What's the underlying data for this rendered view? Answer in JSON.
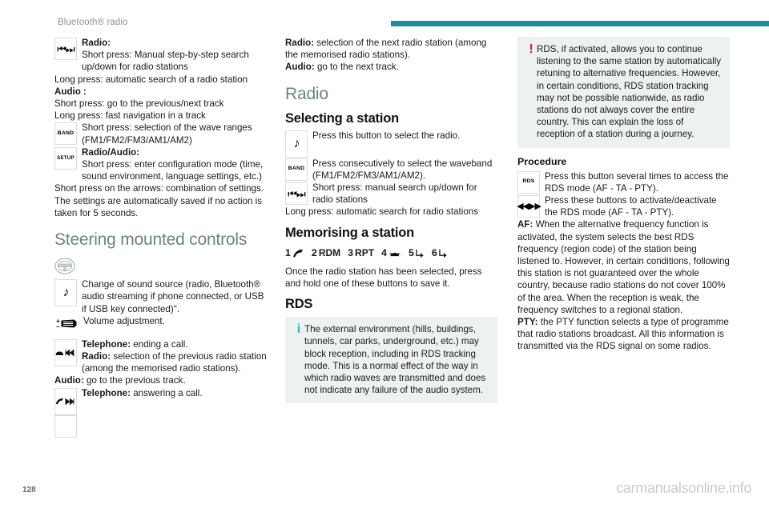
{
  "header": {
    "title": "Bluetooth® radio",
    "rule_color": "#1b8e98"
  },
  "footer": {
    "page_number": "128",
    "watermark": "carmanualsonline.info"
  },
  "column1": {
    "block_prev_next": {
      "icon": "prev-next-track-icon",
      "icon_glyph": "⏮⏭",
      "line1_label": "Radio:",
      "line1_text": "Short press: Manual step-by-step search up/down for radio stations",
      "line2": "Long press: automatic search of a radio station",
      "line3_label": "Audio :",
      "line4": "Short press: go to the previous/next track",
      "line5": "Long press: fast navigation in a track"
    },
    "block_band": {
      "icon_label": "BAND",
      "text": "Short press: selection of the wave ranges (FM1/FM2/FM3/AM1/AM2)"
    },
    "block_setup": {
      "icon_label": "SETUP",
      "line1_label": "Radio/Audio:",
      "line1_text": "Short press: enter configuration mode (time, sound environment, language settings, etc.)",
      "line2": "Short press on the arrows: combination of settings.",
      "line3": "The settings are automatically saved if no action is taken for 5 seconds."
    },
    "heading_steering": "Steering mounted controls",
    "block_source": {
      "wheel_icon": "steering-wheel-icon",
      "icon_glyph": "♪",
      "text": "Change of sound source (radio, Bluetooth® audio streaming if phone connected, or USB if USB key connected)\"."
    },
    "block_volume": {
      "plus": "+",
      "minus": "–",
      "text": "Volume adjustment."
    },
    "block_end_call": {
      "icon": "end-call-prev-track-icon",
      "line1_label": "Telephone:",
      "line1_text": "ending a call.",
      "line2_label": "Radio:",
      "line2_text": "selection of the previous radio station (among the memorised radio stations).",
      "line3_label": "Audio:",
      "line3_text": "go to the previous track."
    },
    "block_answer_call": {
      "icon": "answer-call-next-track-icon",
      "label": "Telephone:",
      "text": "answering a call."
    }
  },
  "column2": {
    "intro": {
      "line1_label": "Radio:",
      "line1_text": "selection of the next radio station (among the memorised radio stations).",
      "line2_label": "Audio:",
      "line2_text": "go to the next track."
    },
    "heading_radio": "Radio",
    "heading_selecting": "Selecting a station",
    "block_source": {
      "icon_glyph": "♪",
      "text": "Press this button to select the radio."
    },
    "block_band": {
      "icon_label": "BAND",
      "text": "Press consecutively to select the waveband (FM1/FM2/FM3/AM1/AM2)."
    },
    "block_search": {
      "icon_glyph": "⏮⏭",
      "text": "Short press: manual search up/down for radio stations"
    },
    "long_press": "Long press: automatic search for radio stations",
    "heading_memorising": "Memorising a station",
    "presets": [
      {
        "number": "1",
        "icon": "answer-call-icon",
        "label": ""
      },
      {
        "number": "2",
        "icon": "",
        "label": "RDM"
      },
      {
        "number": "3",
        "icon": "",
        "label": "RPT"
      },
      {
        "number": "4",
        "icon": "telephone-icon",
        "label": ""
      },
      {
        "number": "5",
        "icon": "arrow-down-right-icon",
        "label": ""
      },
      {
        "number": "6",
        "icon": "arrow-down-right-icon",
        "label": ""
      }
    ],
    "presets_text": "Once the radio station has been selected, press and hold one of these buttons to save it.",
    "heading_rds": "RDS",
    "info_box": {
      "mark": "i",
      "mark_color": "#29b6dd",
      "text": "The external environment (hills, buildings, tunnels, car parks, underground, etc.) may block reception, including in RDS tracking mode. This is a normal effect of the way in which radio waves are transmitted and does not indicate any failure of the audio system."
    }
  },
  "column3": {
    "warning_box": {
      "mark": "!",
      "mark_color": "#e8112d",
      "text": "RDS, if activated, allows you to continue listening to the same station by automatically retuning to alternative frequencies. However, in certain conditions, RDS station tracking may not be possible nationwide, as radio stations do not always cover the entire country. This can explain the loss of reception of a station during a journey."
    },
    "heading_procedure": "Procedure",
    "block_rds": {
      "icon_label": "RDS",
      "text": "Press this button several times to access the RDS mode (AF - TA - PTY)."
    },
    "block_arrows": {
      "icon_glyph": "◀◀▶▶",
      "text": "Press these buttons to activate/deactivate the RDS mode (AF - TA - PTY)."
    },
    "af": {
      "label": "AF:",
      "text": "When the alternative frequency function is activated, the system selects the best RDS frequency (region code) of the station being listened to. However, in certain conditions, following this station is not guaranteed over the whole country, because radio stations do not cover 100% of the area. When the reception is weak, the frequency switches to a regional station."
    },
    "pty": {
      "label": "PTY:",
      "text": "the PTY function selects a type of programme that radio stations broadcast. All this information is transmitted via the RDS signal on some radios."
    }
  }
}
